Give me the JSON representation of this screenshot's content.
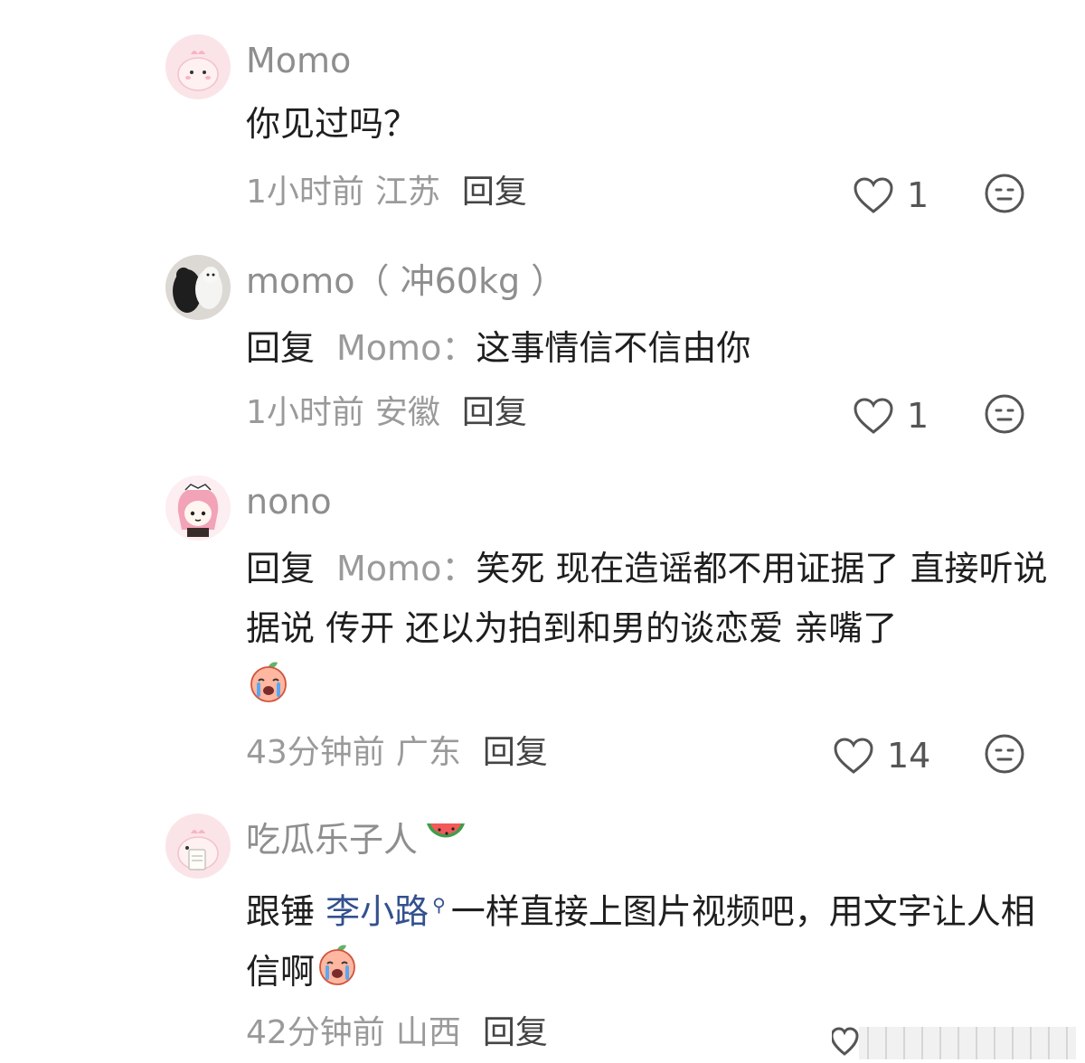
{
  "comments": [
    {
      "username": "Momo",
      "text": "你见过吗？",
      "meta": {
        "time": "1小时前",
        "location": "江苏",
        "reply_label": "回复"
      },
      "likes": "1",
      "avatar": "pink-blob-avatar"
    },
    {
      "username": "momo（ 冲60kg ）",
      "reply_prefix": "回复",
      "reply_target": "Momo：",
      "text": "这事情信不信由你",
      "meta": {
        "time": "1小时前",
        "location": "安徽",
        "reply_label": "回复"
      },
      "likes": "1",
      "avatar": "cats-photo-avatar"
    },
    {
      "username": "nono",
      "reply_prefix": "回复",
      "reply_target": "Momo：",
      "text": "笑死 现在造谣都不用证据了 直接听说 据说 传开 还以为拍到和男的谈恋爱 亲嘴了",
      "meta": {
        "time": "43分钟前",
        "location": "广东",
        "reply_label": "回复"
      },
      "likes": "14",
      "avatar": "pink-hair-girl-avatar"
    },
    {
      "username": "吃瓜乐子人",
      "text_before": "跟锤",
      "mention": "李小路",
      "text_after": "一样直接上图片视频吧，用文字让人相信啊",
      "meta": {
        "time": "42分钟前",
        "location": "山西",
        "reply_label": "回复"
      },
      "avatar": "pink-blob-clipboard-avatar"
    }
  ],
  "icons": {
    "like": "heart-outline-icon",
    "more": "neutral-face-icon",
    "crying_emoji": "crying-peach-emoji",
    "watermelon": "watermelon-emoji",
    "search": "search-small-icon"
  },
  "colors": {
    "username": "#8e8e8e",
    "meta": "#9a9a9a",
    "mention": "#33508f",
    "text": "#1e1e1e"
  }
}
